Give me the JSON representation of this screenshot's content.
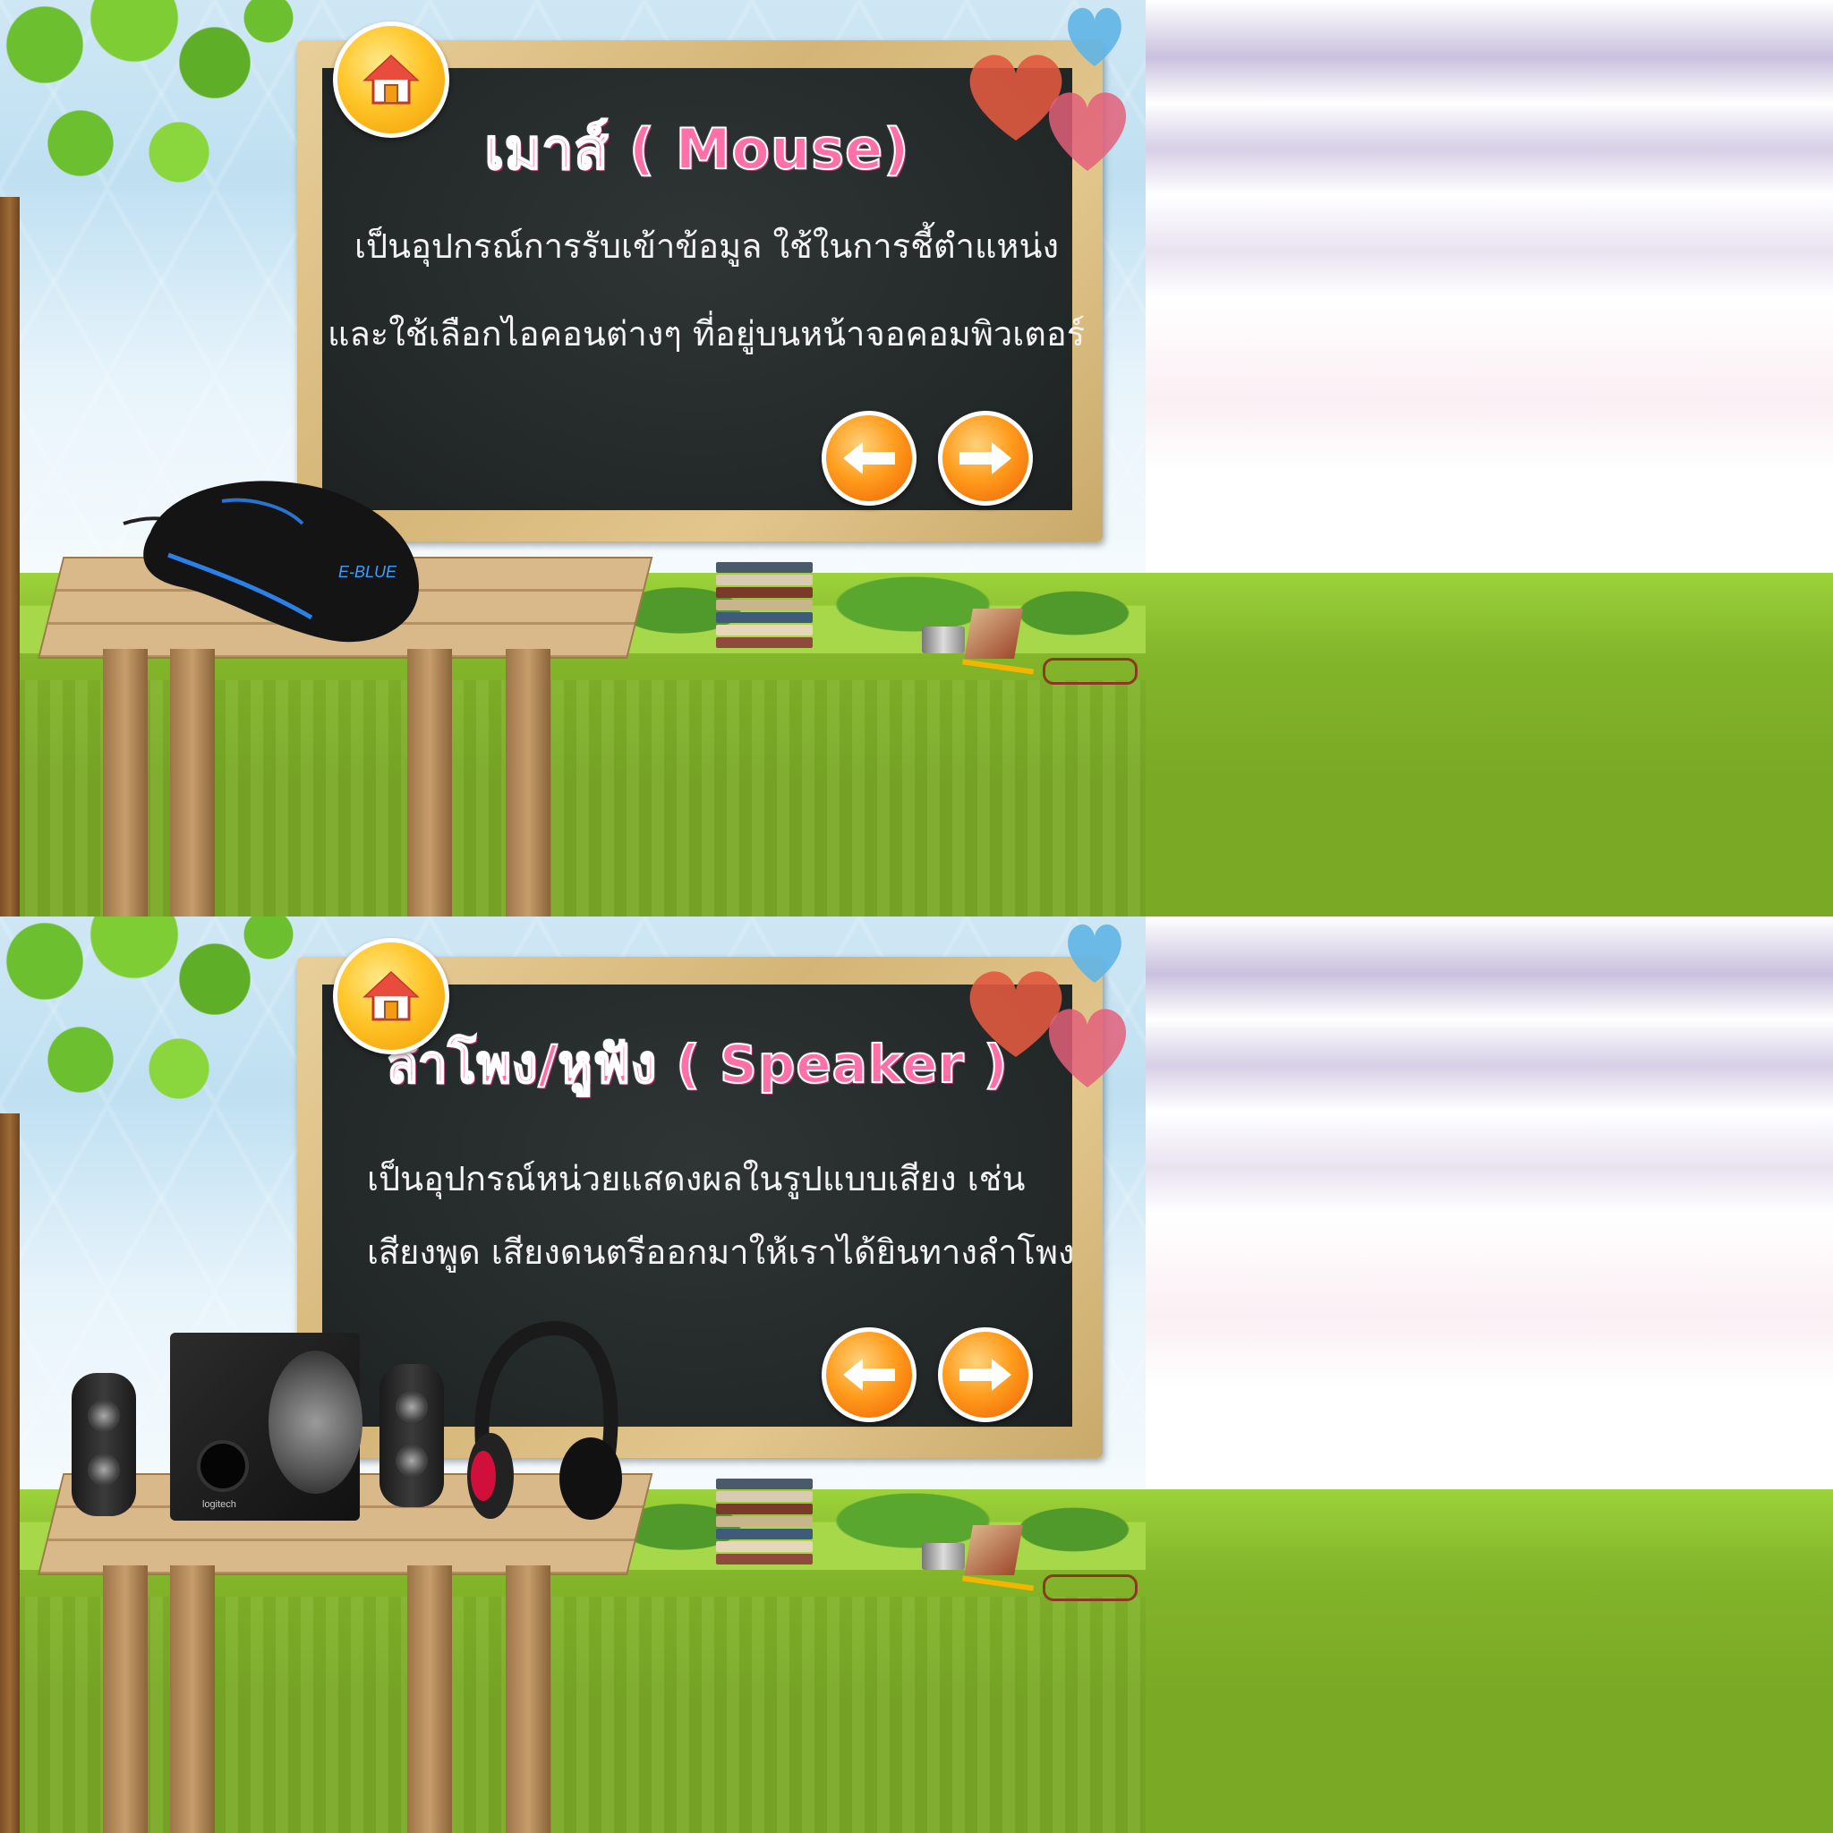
{
  "slides": [
    {
      "title": "เมาส์ ( Mouse)",
      "lines": [
        "เป็นอุปกรณ์การรับเข้าข้อมูล  ใช้ในการชี้ตำแหน่ง",
        "และใช้เลือกไอคอนต่างๆ  ที่อยู่บนหน้าจอคอมพิวเตอร์"
      ],
      "device_icon": "gaming-mouse",
      "mouse_brand": "E-BLUE"
    },
    {
      "title": "ลำโพง/หูฟัง ( Speaker )",
      "lines": [
        "เป็นอุปกรณ์หน่วยแสดงผลในรูปแบบเสียง  เช่น",
        "เสียงพูด  เสียงดนตรีออกมาให้เราได้ยินทางลำโพง"
      ],
      "device_icon": "speakers-headphones",
      "speaker_brand": "logitech"
    }
  ],
  "icons": {
    "home": "home-icon",
    "prev": "arrow-left-icon",
    "next": "arrow-right-icon"
  },
  "colors": {
    "title_pink": "#ff6fa8",
    "board": "#252a2a",
    "frame": "#d9bb7d",
    "button_orange": "#ff9d1e"
  }
}
